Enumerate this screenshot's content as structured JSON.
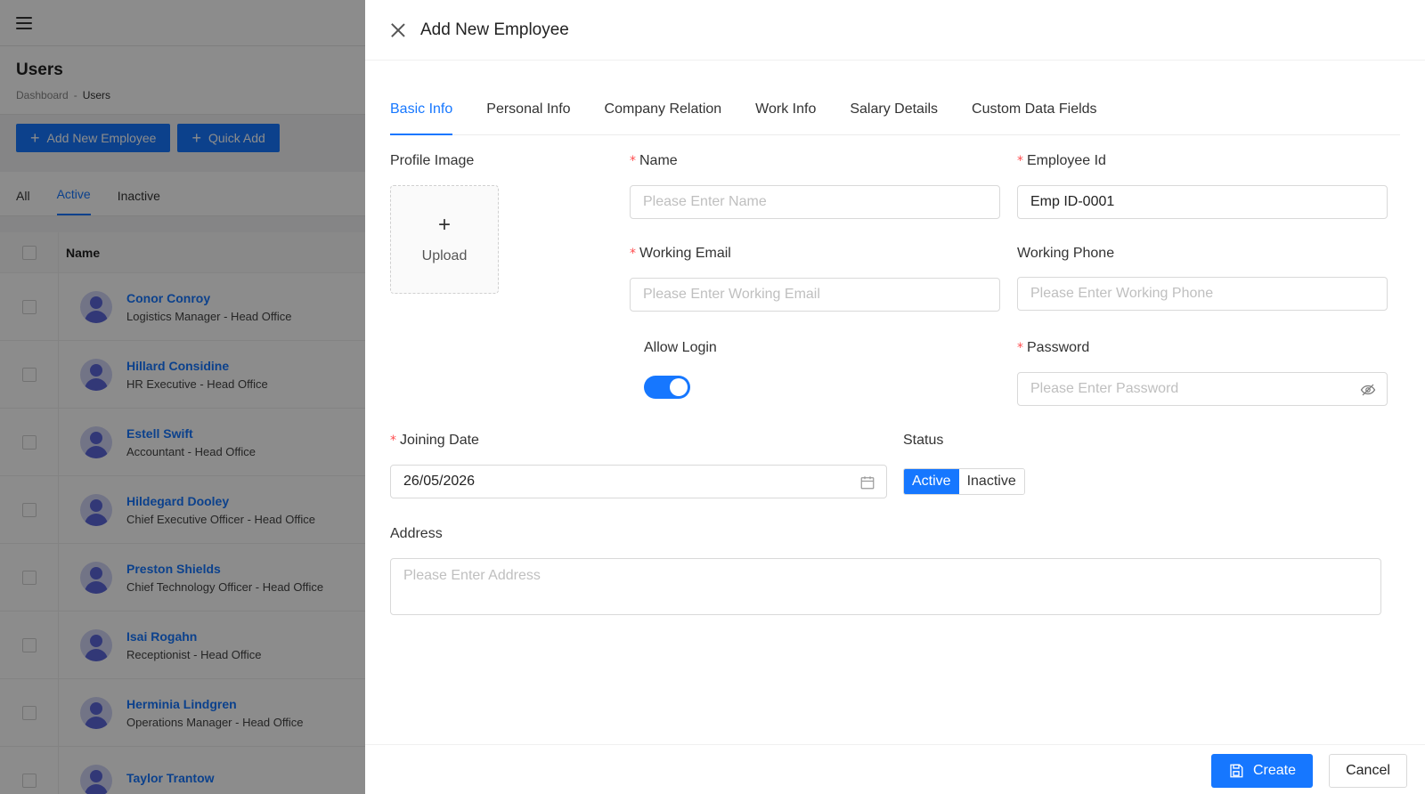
{
  "background": {
    "page_title": "Users",
    "breadcrumb": [
      "Dashboard",
      "Users"
    ],
    "breadcrumb_sep": "-",
    "actions": [
      "Add New Employee",
      "Quick Add"
    ],
    "tabs": [
      "All",
      "Active",
      "Inactive"
    ],
    "active_tab": "Active",
    "table_header": "Name",
    "rows": [
      {
        "name": "Conor Conroy",
        "role": "Logistics Manager - Head Office"
      },
      {
        "name": "Hillard Considine",
        "role": "HR Executive - Head Office"
      },
      {
        "name": "Estell Swift",
        "role": "Accountant - Head Office"
      },
      {
        "name": "Hildegard Dooley",
        "role": "Chief Executive Officer - Head Office"
      },
      {
        "name": "Preston Shields",
        "role": "Chief Technology Officer - Head Office"
      },
      {
        "name": "Isai Rogahn",
        "role": "Receptionist - Head Office"
      },
      {
        "name": "Herminia Lindgren",
        "role": "Operations Manager - Head Office"
      },
      {
        "name": "Taylor Trantow",
        "role": ""
      }
    ]
  },
  "drawer": {
    "title": "Add New Employee",
    "tabs": [
      "Basic Info",
      "Personal Info",
      "Company Relation",
      "Work Info",
      "Salary Details",
      "Custom Data Fields"
    ],
    "active_tab": "Basic Info",
    "profile_image_label": "Profile Image",
    "upload_label": "Upload",
    "name": {
      "label": "Name",
      "required": true,
      "placeholder": "Please Enter Name",
      "value": ""
    },
    "employee_id": {
      "label": "Employee Id",
      "required": true,
      "value": "Emp ID-0001"
    },
    "working_email": {
      "label": "Working Email",
      "required": true,
      "placeholder": "Please Enter Working Email"
    },
    "working_phone": {
      "label": "Working Phone",
      "required": false,
      "placeholder": "Please Enter Working Phone"
    },
    "allow_login": {
      "label": "Allow Login",
      "on": true
    },
    "password": {
      "label": "Password",
      "required": true,
      "placeholder": "Please Enter Password"
    },
    "joining_date": {
      "label": "Joining Date",
      "required": true,
      "value": "26/05/2026"
    },
    "status": {
      "label": "Status",
      "options": [
        "Active",
        "Inactive"
      ],
      "selected": "Active"
    },
    "address": {
      "label": "Address",
      "placeholder": "Please Enter Address"
    },
    "footer": {
      "create_label": "Create",
      "cancel_label": "Cancel"
    }
  },
  "colors": {
    "primary": "#1677ff",
    "required": "#ff4d4f",
    "overlay": "rgba(0,0,0,0.45)"
  }
}
